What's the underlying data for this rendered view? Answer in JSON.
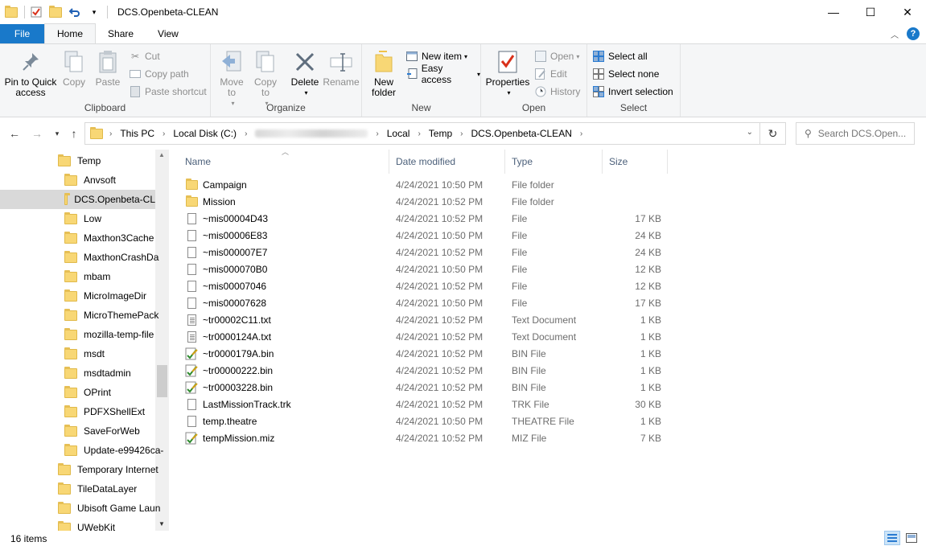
{
  "window": {
    "title": "DCS.Openbeta-CLEAN",
    "minimize": "—",
    "maximize": "☐",
    "close": "✕"
  },
  "ribbon_tabs": {
    "file": "File",
    "home": "Home",
    "share": "Share",
    "view": "View"
  },
  "ribbon": {
    "clipboard": {
      "label": "Clipboard",
      "pin": "Pin to Quick access",
      "copy": "Copy",
      "paste": "Paste",
      "cut": "Cut",
      "copy_path": "Copy path",
      "paste_shortcut": "Paste shortcut"
    },
    "organize": {
      "label": "Organize",
      "move_to": "Move to",
      "copy_to": "Copy to",
      "delete": "Delete",
      "rename": "Rename"
    },
    "new": {
      "label": "New",
      "new_folder": "New folder",
      "new_item": "New item",
      "easy_access": "Easy access"
    },
    "open": {
      "label": "Open",
      "properties": "Properties",
      "open": "Open",
      "edit": "Edit",
      "history": "History"
    },
    "select": {
      "label": "Select",
      "select_all": "Select all",
      "select_none": "Select none",
      "invert_selection": "Invert selection"
    }
  },
  "address": {
    "crumbs": [
      "This PC",
      "Local Disk (C:)",
      "Local",
      "Temp",
      "DCS.Openbeta-CLEAN"
    ]
  },
  "search": {
    "placeholder": "Search DCS.Open..."
  },
  "nav_tree": [
    "Temp",
    "Anvsoft",
    "DCS.Openbeta-CL",
    "Low",
    "Maxthon3Cache",
    "MaxthonCrashDa",
    "mbam",
    "MicroImageDir",
    "MicroThemePack",
    "mozilla-temp-file",
    "msdt",
    "msdtadmin",
    "OPrint",
    "PDFXShellExt",
    "SaveForWeb",
    "Update-e99426ca-",
    "Temporary Internet",
    "TileDataLayer",
    "Ubisoft Game Laun",
    "UWebKit"
  ],
  "columns": {
    "name": "Name",
    "date": "Date modified",
    "type": "Type",
    "size": "Size"
  },
  "files": [
    {
      "name": "Campaign",
      "date": "4/24/2021 10:50 PM",
      "type": "File folder",
      "size": "",
      "icon": "folder-icon"
    },
    {
      "name": "Mission",
      "date": "4/24/2021 10:52 PM",
      "type": "File folder",
      "size": "",
      "icon": "folder-icon"
    },
    {
      "name": "~mis00004D43",
      "date": "4/24/2021 10:52 PM",
      "type": "File",
      "size": "17 KB",
      "icon": "file-icon"
    },
    {
      "name": "~mis00006E83",
      "date": "4/24/2021 10:50 PM",
      "type": "File",
      "size": "24 KB",
      "icon": "file-icon"
    },
    {
      "name": "~mis000007E7",
      "date": "4/24/2021 10:52 PM",
      "type": "File",
      "size": "24 KB",
      "icon": "file-icon"
    },
    {
      "name": "~mis000070B0",
      "date": "4/24/2021 10:50 PM",
      "type": "File",
      "size": "12 KB",
      "icon": "file-icon"
    },
    {
      "name": "~mis00007046",
      "date": "4/24/2021 10:52 PM",
      "type": "File",
      "size": "12 KB",
      "icon": "file-icon"
    },
    {
      "name": "~mis00007628",
      "date": "4/24/2021 10:50 PM",
      "type": "File",
      "size": "17 KB",
      "icon": "file-icon"
    },
    {
      "name": "~tr00002C11.txt",
      "date": "4/24/2021 10:52 PM",
      "type": "Text Document",
      "size": "1 KB",
      "icon": "text-file-icon"
    },
    {
      "name": "~tr0000124A.txt",
      "date": "4/24/2021 10:52 PM",
      "type": "Text Document",
      "size": "1 KB",
      "icon": "text-file-icon"
    },
    {
      "name": "~tr0000179A.bin",
      "date": "4/24/2021 10:52 PM",
      "type": "BIN File",
      "size": "1 KB",
      "icon": "edit-file-icon"
    },
    {
      "name": "~tr00000222.bin",
      "date": "4/24/2021 10:52 PM",
      "type": "BIN File",
      "size": "1 KB",
      "icon": "edit-file-icon"
    },
    {
      "name": "~tr00003228.bin",
      "date": "4/24/2021 10:52 PM",
      "type": "BIN File",
      "size": "1 KB",
      "icon": "edit-file-icon"
    },
    {
      "name": "LastMissionTrack.trk",
      "date": "4/24/2021 10:52 PM",
      "type": "TRK File",
      "size": "30 KB",
      "icon": "file-icon"
    },
    {
      "name": "temp.theatre",
      "date": "4/24/2021 10:50 PM",
      "type": "THEATRE File",
      "size": "1 KB",
      "icon": "file-icon"
    },
    {
      "name": "tempMission.miz",
      "date": "4/24/2021 10:52 PM",
      "type": "MIZ File",
      "size": "7 KB",
      "icon": "edit-file-icon"
    }
  ],
  "status": {
    "count": "16 items"
  },
  "colors": {
    "file_tab": "#1979ca",
    "folder": "#f8d775",
    "selected": "#d9d9d9",
    "header_text": "#4c607a"
  }
}
